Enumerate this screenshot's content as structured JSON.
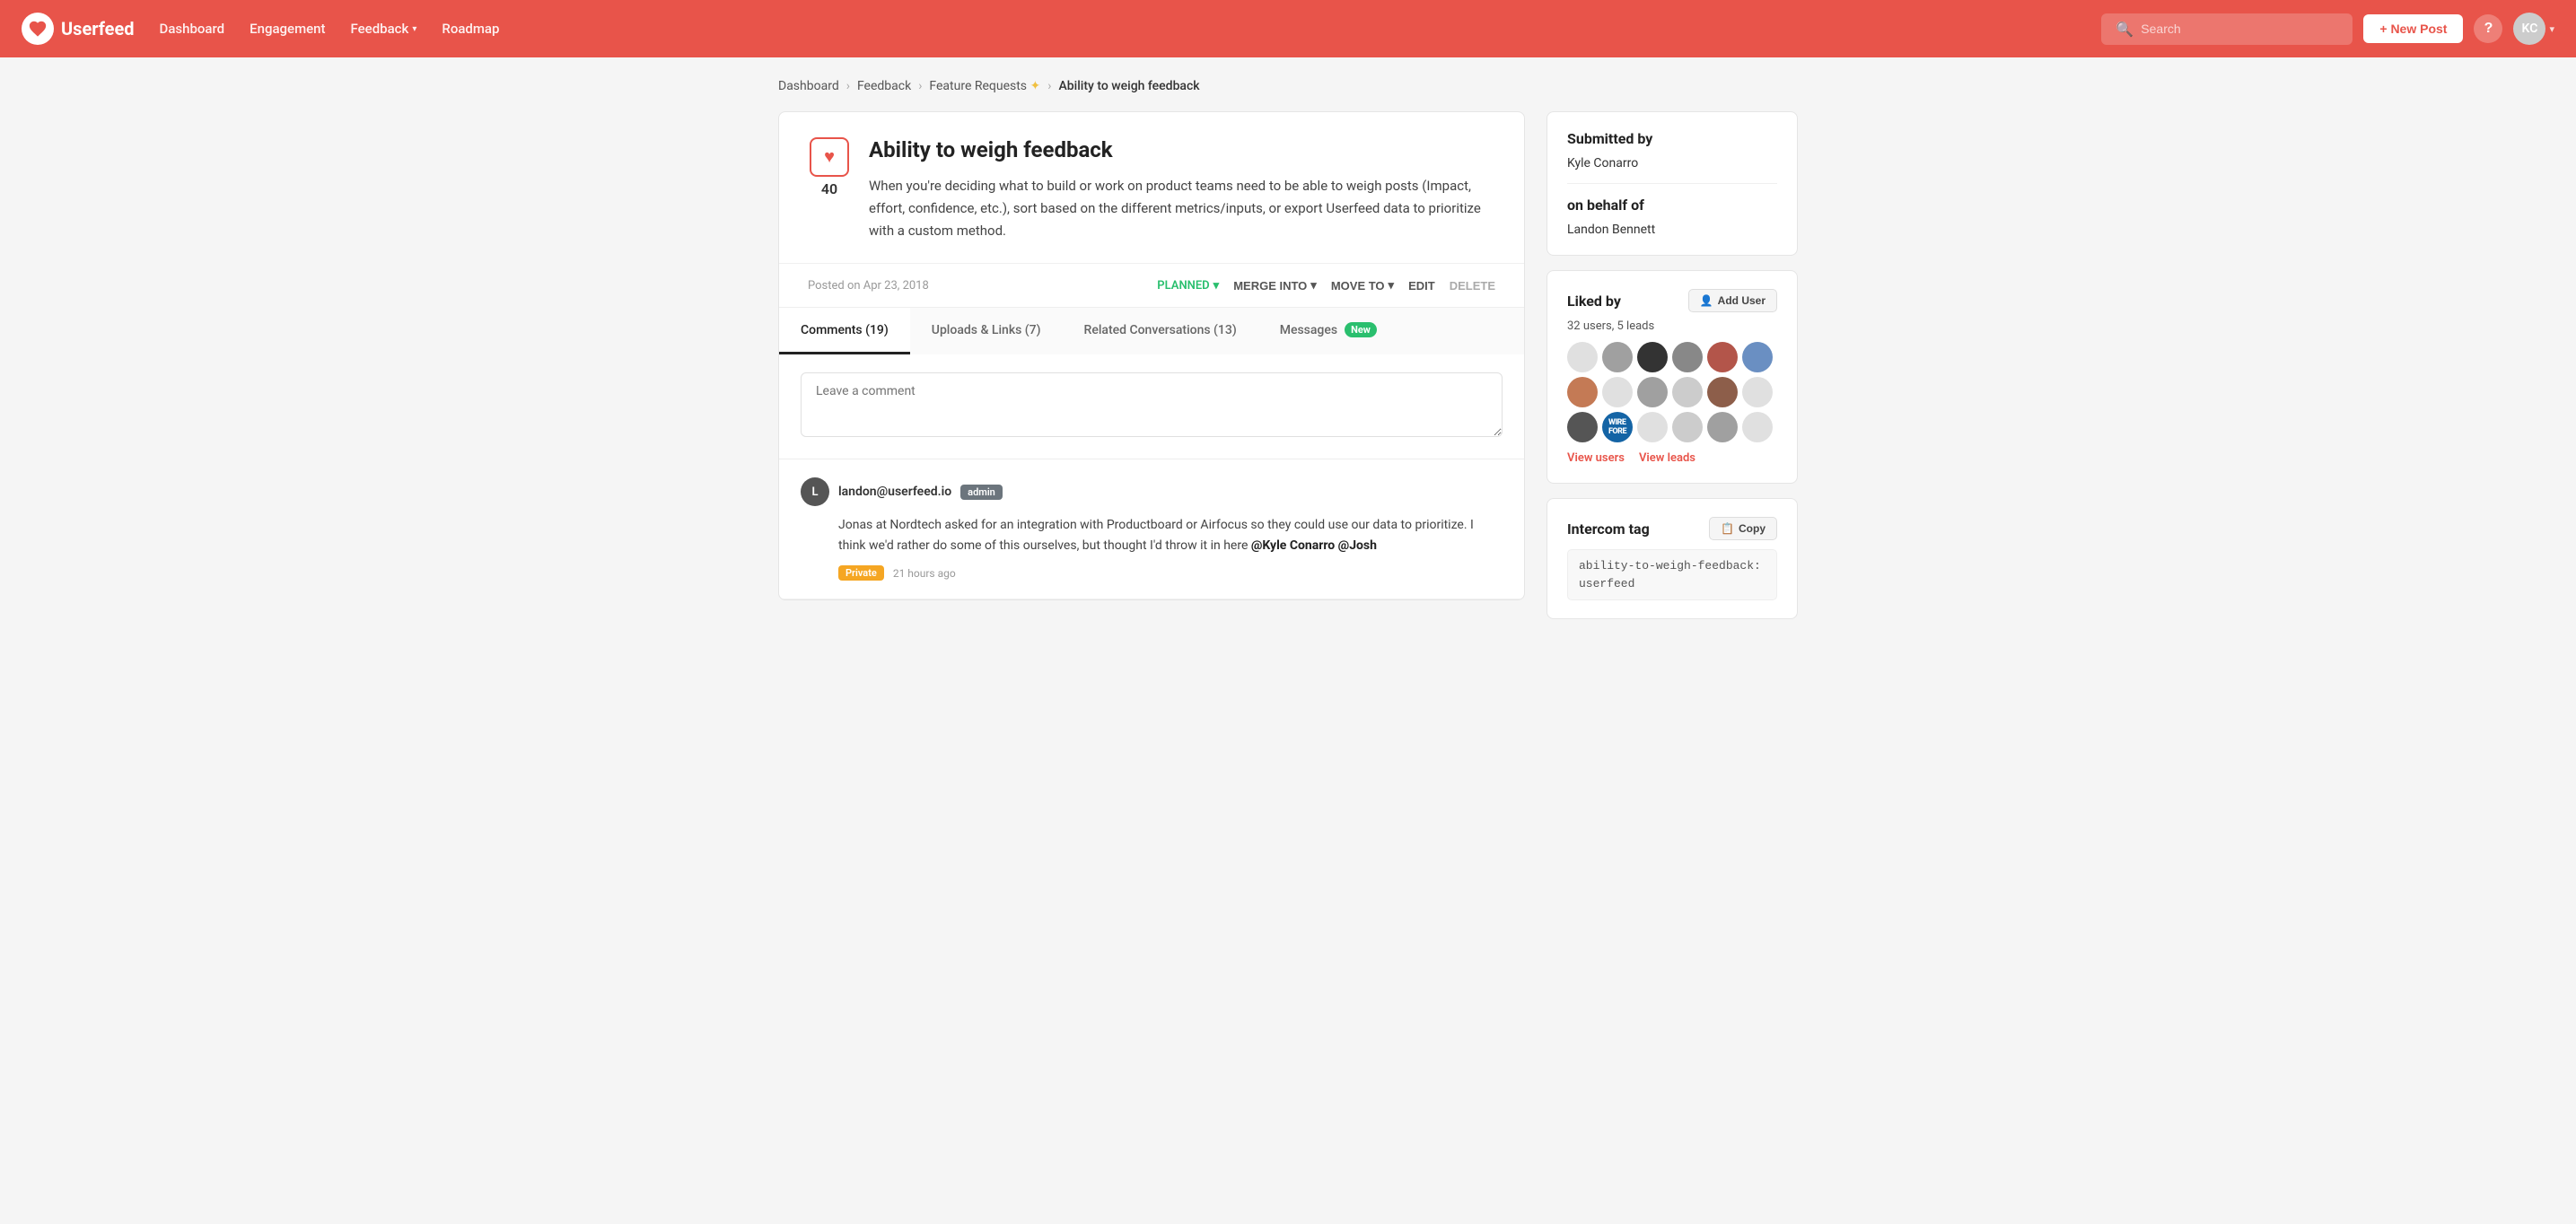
{
  "navbar": {
    "brand": "Userfeed",
    "links": [
      {
        "label": "Dashboard",
        "id": "dashboard"
      },
      {
        "label": "Engagement",
        "id": "engagement"
      },
      {
        "label": "Feedback",
        "id": "feedback",
        "hasDropdown": true
      },
      {
        "label": "Roadmap",
        "id": "roadmap"
      }
    ],
    "search_placeholder": "Search",
    "new_post_label": "+ New Post",
    "help_label": "?",
    "avatar_initials": "KC"
  },
  "breadcrumb": {
    "items": [
      {
        "label": "Dashboard",
        "id": "bc-dashboard"
      },
      {
        "label": "Feedback",
        "id": "bc-feedback"
      },
      {
        "label": "Feature Requests",
        "id": "bc-feature-requests",
        "hasStar": true
      },
      {
        "label": "Ability to weigh feedback",
        "id": "bc-current"
      }
    ]
  },
  "post": {
    "title": "Ability to weigh feedback",
    "body": "When you're deciding what to build or work on product teams need to be able to weigh posts (Impact, effort, confidence, etc.), sort based on the different metrics/inputs, or export Userfeed data to prioritize with a custom method.",
    "vote_count": "40",
    "date": "Posted on Apr 23, 2018",
    "actions": {
      "status_label": "PLANNED",
      "merge_into_label": "MERGE INTO",
      "move_to_label": "MOVE TO",
      "edit_label": "EDIT",
      "delete_label": "DELETE"
    }
  },
  "tabs": [
    {
      "label": "Comments (19)",
      "id": "comments",
      "active": true
    },
    {
      "label": "Uploads & Links (7)",
      "id": "uploads"
    },
    {
      "label": "Related Conversations (13)",
      "id": "conversations"
    },
    {
      "label": "Messages",
      "id": "messages",
      "badge": "New"
    }
  ],
  "comment_box": {
    "placeholder": "Leave a comment"
  },
  "comments": [
    {
      "author": "landon@userfeed.io",
      "admin": true,
      "avatar_initials": "L",
      "body_html": "Jonas at Nordtech asked for an integration with Productboard or Airfocus so they could use our data to prioritize. I think we'd rather do some of this ourselves, but thought I'd throw it in here <strong>@Kyle Conarro @Josh</strong>",
      "private": true,
      "time": "21 hours ago"
    }
  ],
  "sidebar": {
    "submitted_by_title": "Submitted by",
    "submitted_by_name": "Kyle Conarro",
    "on_behalf_of_label": "on behalf of",
    "on_behalf_of_name": "Landon Bennett",
    "liked_by_title": "Liked by",
    "add_user_label": "Add User",
    "liked_count": "32 users, 5 leads",
    "view_users_label": "View users",
    "view_leads_label": "View leads",
    "intercom_tag_title": "Intercom tag",
    "copy_label": "Copy",
    "tag_value": "ability-to-weigh-feedback:userfeed"
  }
}
